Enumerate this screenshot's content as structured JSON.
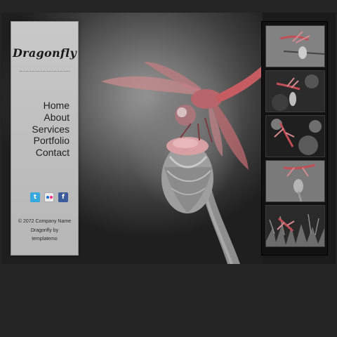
{
  "site": {
    "title": "Dragonfly"
  },
  "nav": {
    "items": [
      {
        "label": "Home"
      },
      {
        "label": "About"
      },
      {
        "label": "Services"
      },
      {
        "label": "Portfolio"
      },
      {
        "label": "Contact"
      }
    ]
  },
  "social": {
    "twitter_glyph": "t",
    "facebook_glyph": "f"
  },
  "footer": {
    "line1": "© 2072 Company Name",
    "line2": "Dragonfly by",
    "line3": "templatemo"
  },
  "colors": {
    "accent": "#c8564c",
    "sidebar": "#c2c2c2",
    "background": "#242424"
  }
}
